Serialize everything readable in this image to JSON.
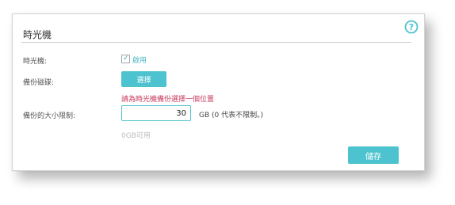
{
  "panel": {
    "title": "時光機",
    "help_icon": "help-circle-icon"
  },
  "fields": {
    "time_machine_label": "時光機:",
    "enable_label": "啟用",
    "enabled": true,
    "backup_dir_label": "備份磁碟:",
    "select_button": "選擇",
    "warning": "請為時光機備份選擇一個位置",
    "size_limit_label": "備份的大小限制:",
    "size_value": "30",
    "size_unit": "GB (0 代表不限制。)",
    "available": "0GB可用"
  },
  "actions": {
    "save_button": "儲存"
  },
  "colors": {
    "accent": "#4dc3cf",
    "warning": "#c7395d"
  }
}
